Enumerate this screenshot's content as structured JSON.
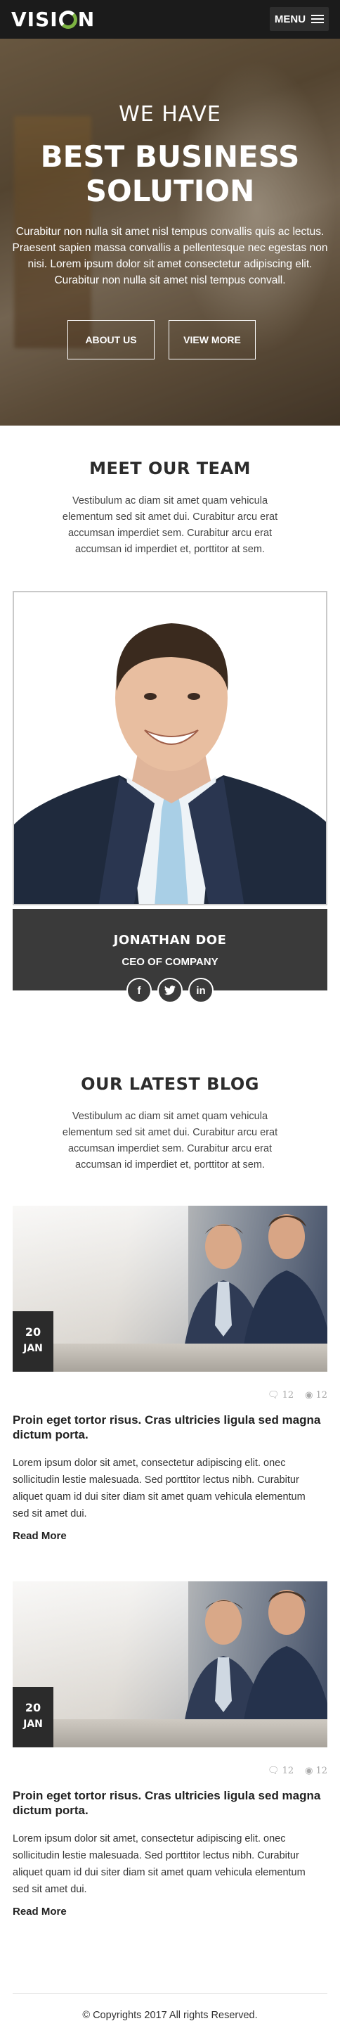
{
  "header": {
    "logo_text": "VISION",
    "menu_label": "MENU"
  },
  "hero": {
    "subtitle": "WE HAVE",
    "title_line1": "BEST BUSINESS",
    "title_line2": "SOLUTION",
    "text": "Curabitur non nulla sit amet nisl tempus convallis quis ac lectus. Praesent sapien massa convallis a pellentesque nec egestas non nisi. Lorem ipsum dolor sit amet consectetur adipiscing elit. Curabitur non nulla sit amet nisl tempus convall.",
    "btn_about": "ABOUT US",
    "btn_more": "VIEW MORE"
  },
  "team": {
    "title": "MEET OUR TEAM",
    "text": "Vestibulum ac diam sit amet quam vehicula elementum sed sit amet dui. Curabitur arcu erat accumsan imperdiet sem. Curabitur arcu erat accumsan id imperdiet et, porttitor at sem.",
    "member_name": "JONATHAN DOE",
    "member_role": "CEO OF COMPANY",
    "social": [
      "f",
      "t",
      "in"
    ]
  },
  "blog": {
    "title": "OUR LATEST BLOG",
    "text": "Vestibulum ac diam sit amet quam vehicula elementum sed sit amet dui. Curabitur arcu erat accumsan imperdiet sem. Curabitur arcu erat accumsan id imperdiet et, porttitor at sem.",
    "posts": [
      {
        "day": "20",
        "month": "JAN",
        "comments": "12",
        "views": "12",
        "title": "Proin eget tortor risus. Cras ultricies ligula sed magna dictum porta.",
        "excerpt": "Lorem ipsum dolor sit amet, consectetur adipiscing elit. onec sollicitudin lestie malesuada. Sed porttitor lectus nibh. Curabitur aliquet quam id dui siter diam sit amet quam vehicula elementum sed sit amet dui.",
        "read_more": "Read More"
      },
      {
        "day": "20",
        "month": "JAN",
        "comments": "12",
        "views": "12",
        "title": "Proin eget tortor risus. Cras ultricies ligula sed magna dictum porta.",
        "excerpt": "Lorem ipsum dolor sit amet, consectetur adipiscing elit. onec sollicitudin lestie malesuada. Sed porttitor lectus nibh. Curabitur aliquet quam id dui siter diam sit amet quam vehicula elementum sed sit amet dui.",
        "read_more": "Read More"
      }
    ]
  },
  "footer": {
    "copyright": "© Copyrights 2017 All rights Reserved."
  },
  "colors": {
    "header_bg": "#1b1b1b",
    "logo_accent": "#7db342",
    "dark_panel": "#3a3a3a"
  }
}
